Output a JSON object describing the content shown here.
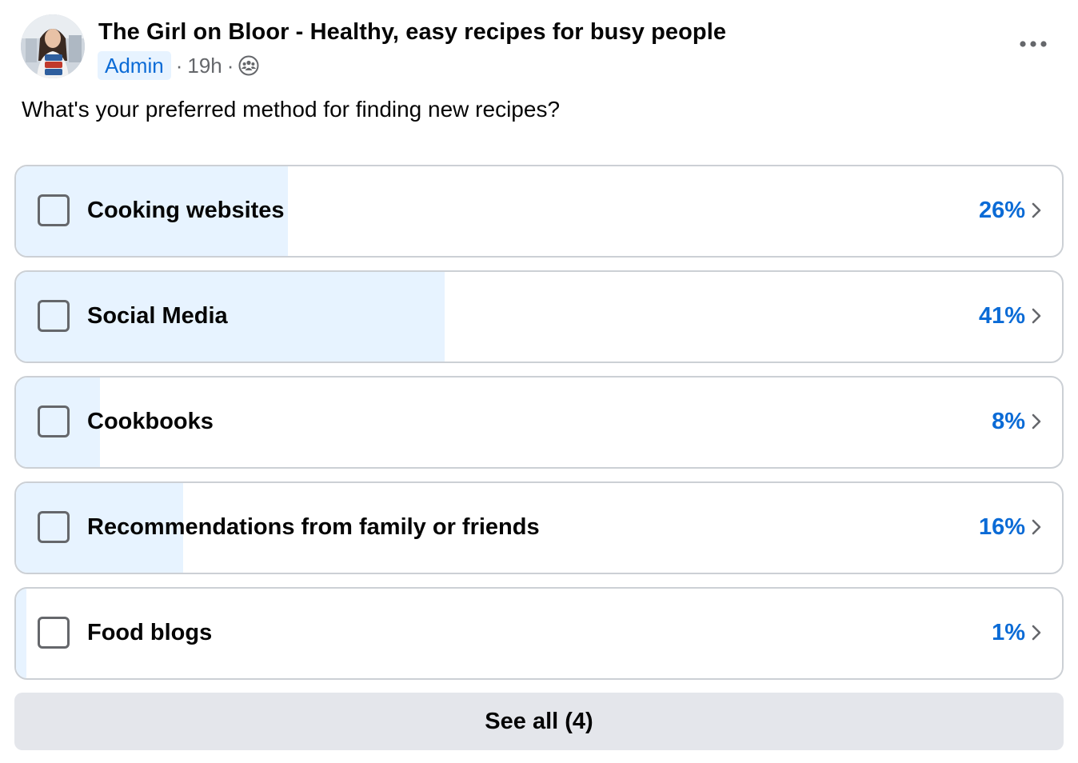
{
  "post": {
    "author": "The Girl on Bloor - Healthy, easy recipes for busy people",
    "badge": "Admin",
    "separator": "·",
    "time": "19h",
    "audience_icon": "group-icon",
    "more_icon": "more-options-icon",
    "question": "What's your preferred method for finding new recipes?"
  },
  "poll": {
    "options": [
      {
        "label": "Cooking websites",
        "percent": 26,
        "percent_label": "26%"
      },
      {
        "label": "Social Media",
        "percent": 41,
        "percent_label": "41%"
      },
      {
        "label": "Cookbooks",
        "percent": 8,
        "percent_label": "8%"
      },
      {
        "label": "Recommendations from family or friends",
        "percent": 16,
        "percent_label": "16%"
      },
      {
        "label": "Food blogs",
        "percent": 1,
        "percent_label": "1%"
      }
    ],
    "see_all_label": "See all (4)"
  },
  "colors": {
    "accent": "#0b6bd6",
    "fill": "#e7f3ff",
    "border": "#ccd0d5",
    "button_bg": "#e4e6eb",
    "muted": "#65676b"
  }
}
